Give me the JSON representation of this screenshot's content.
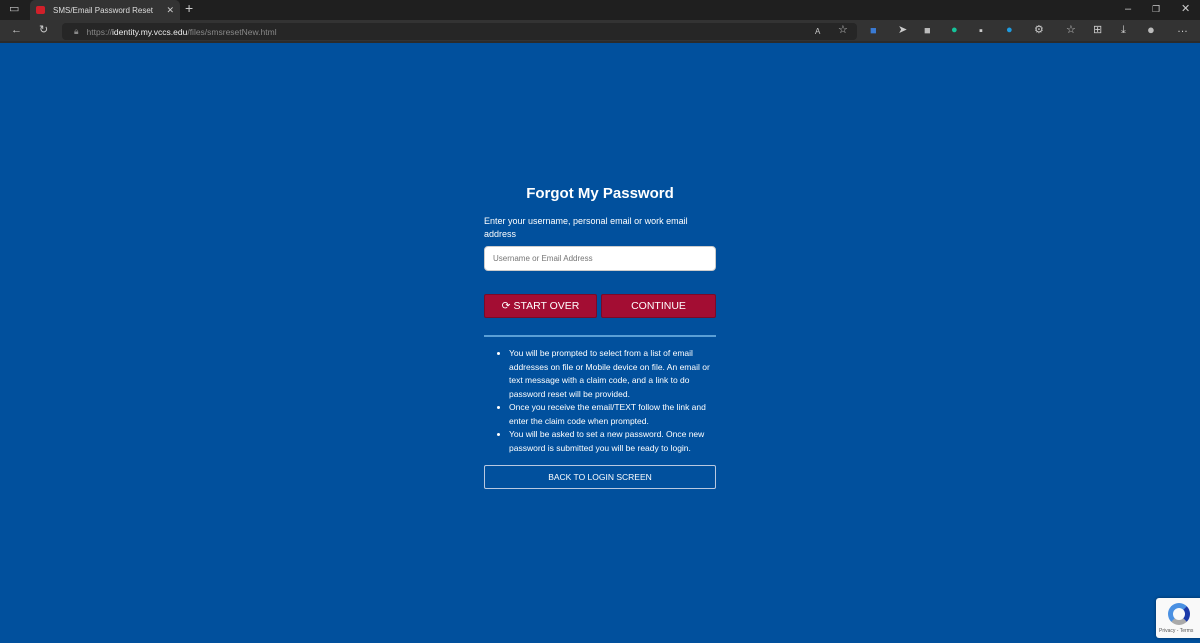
{
  "browser": {
    "tab_title": "SMS/Email Password Reset",
    "url_prefix": "https://",
    "url_host": "identity.my.vccs.edu",
    "url_path": "/files/smsresetNew.html"
  },
  "page": {
    "title": "Forgot My Password",
    "instruction": "Enter your username, personal email or work email address",
    "input_placeholder": "Username or Email Address",
    "start_over": "START OVER",
    "continue": "CONTINUE",
    "bullets": [
      "You will be prompted to select from a list of email addresses on file or Mobile device on file. An email or text message with a claim code, and a link to do password reset will be provided.",
      "Once you receive the email/TEXT follow the link and enter the claim code when prompted.",
      "You will be asked to set a new password. Once new password is submitted you will be ready to login."
    ],
    "back": "BACK TO LOGIN SCREEN"
  },
  "recaptcha": {
    "text": "Privacy - Terms"
  },
  "colors": {
    "background": "#01509d",
    "button": "#a30d33"
  }
}
